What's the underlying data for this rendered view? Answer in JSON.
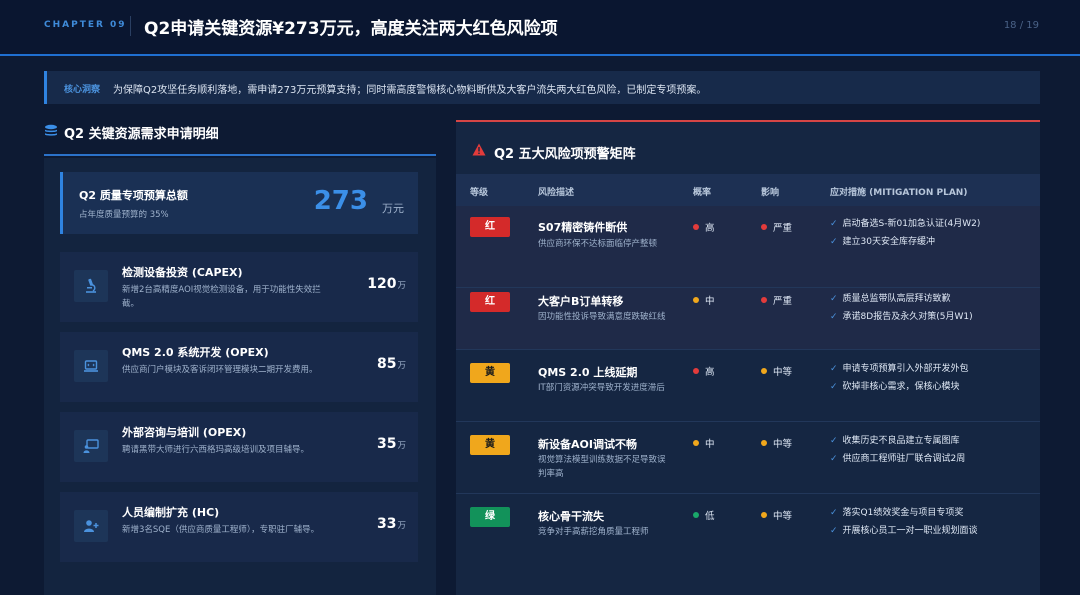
{
  "header": {
    "chapter": "CHAPTER 09",
    "title": "Q2申请关键资源¥273万元，高度关注两大红色风险项",
    "page": "18 / 19"
  },
  "insight": {
    "tag": "核心洞察",
    "text": "为保障Q2攻坚任务顺利落地，需申请273万元预算支持；同时需高度警惕核心物料断供及大客户流失两大红色风险，已制定专项预案。"
  },
  "left": {
    "title": "Q2 关键资源需求申请明细",
    "budget": {
      "title": "Q2 质量专项预算总额",
      "sub": "占年度质量预算的 35%",
      "value": "273",
      "unit": "万元"
    },
    "items": [
      {
        "title": "检测设备投资 (CAPEX)",
        "desc": "新增2台高精度AOI视觉检测设备，用于功能性失效拦截。",
        "value": "120",
        "unit": "万",
        "icon": "microscope-icon"
      },
      {
        "title": "QMS 2.0 系统开发 (OPEX)",
        "desc": "供应商门户模块及客诉闭环管理模块二期开发费用。",
        "value": "85",
        "unit": "万",
        "icon": "laptop-code-icon"
      },
      {
        "title": "外部咨询与培训 (OPEX)",
        "desc": "聘请黑带大师进行六西格玛高级培训及项目辅导。",
        "value": "35",
        "unit": "万",
        "icon": "teacher-board-icon"
      },
      {
        "title": "人员编制扩充 (HC)",
        "desc": "新增3名SQE（供应商质量工程师），专职驻厂辅导。",
        "value": "33",
        "unit": "万",
        "icon": "user-plus-icon"
      }
    ]
  },
  "right": {
    "title": "Q2 五大风险项预警矩阵",
    "columns": {
      "level": "等级",
      "desc": "风险描述",
      "prob": "概率",
      "impact": "影响",
      "plan": "应对措施 (MITIGATION PLAN)"
    },
    "rows": [
      {
        "level": "红",
        "title": "S07精密铸件断供",
        "desc": "供应商环保不达标面临停产整顿",
        "prob": "高",
        "impact": "严重",
        "plans": [
          "启动备选S-新01加急认证(4月W2)",
          "建立30天安全库存缓冲"
        ]
      },
      {
        "level": "红",
        "title": "大客户B订单转移",
        "desc": "因功能性投诉导致满意度跌破红线",
        "prob": "中",
        "impact": "严重",
        "plans": [
          "质量总监带队高层拜访致歉",
          "承诺8D报告及永久对策(5月W1)"
        ]
      },
      {
        "level": "黄",
        "title": "QMS 2.0 上线延期",
        "desc": "IT部门资源冲突导致开发进度滞后",
        "prob": "高",
        "impact": "中等",
        "plans": [
          "申请专项预算引入外部开发外包",
          "砍掉非核心需求，保核心模块"
        ]
      },
      {
        "level": "黄",
        "title": "新设备AOI调试不畅",
        "desc": "视觉算法模型训练数据不足导致误判率高",
        "prob": "中",
        "impact": "中等",
        "plans": [
          "收集历史不良品建立专属图库",
          "供应商工程师驻厂联合调试2周"
        ]
      },
      {
        "level": "绿",
        "title": "核心骨干流失",
        "desc": "竞争对手高薪挖角质量工程师",
        "prob": "低",
        "impact": "中等",
        "plans": [
          "落实Q1绩效奖金与项目专项奖",
          "开展核心员工一对一职业规划面谈"
        ]
      }
    ]
  },
  "colors": {
    "accent": "#2f83e0",
    "red": "#d42a2a",
    "yellow": "#f0a71c",
    "green": "#12925a",
    "dot_high": "#e23b3b",
    "dot_mid": "#f0a71c",
    "dot_low": "#1aa86a"
  }
}
